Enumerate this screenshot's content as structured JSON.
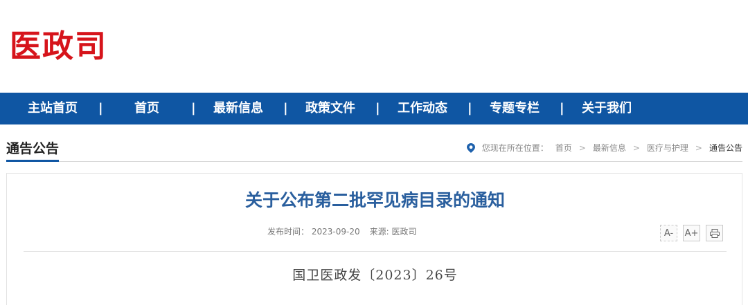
{
  "logo": {
    "text": "医政司"
  },
  "nav": {
    "items": [
      "主站首页",
      "首页",
      "最新信息",
      "政策文件",
      "工作动态",
      "专题专栏",
      "关于我们"
    ],
    "separator": "|"
  },
  "section": {
    "title": "通告公告"
  },
  "breadcrumb": {
    "prefix": "您现在所在位置：",
    "items": [
      "首页",
      "最新信息",
      "医疗与护理",
      "通告公告"
    ],
    "separator": ">"
  },
  "article": {
    "title": "关于公布第二批罕见病目录的通知",
    "publish_label": "发布时间：",
    "publish_date": "2023-09-20",
    "source_label": "来源:",
    "source_value": "医政司",
    "doc_number": "国卫医政发〔2023〕26号"
  },
  "tools": {
    "font_decrease": "A-",
    "font_increase": "A+",
    "print": "print-icon"
  },
  "colors": {
    "brand_red": "#d6141b",
    "nav_blue": "#0f56a3",
    "title_blue": "#2a5f9e"
  }
}
